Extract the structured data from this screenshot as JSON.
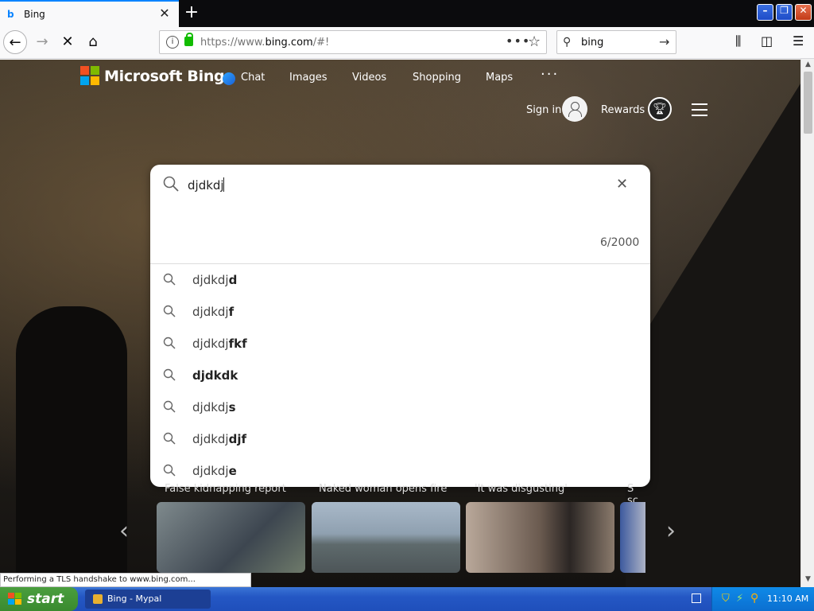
{
  "browser": {
    "tab_title": "Bing",
    "tab_favicon": "b",
    "url_host": "https://www.",
    "url_domain": "bing.com",
    "url_path": "/#!",
    "search_value": "bing",
    "status_text": "Performing a TLS handshake to www.bing.com..."
  },
  "bing": {
    "brand": "Microsoft Bing",
    "nav": [
      "Chat",
      "Images",
      "Videos",
      "Shopping",
      "Maps"
    ],
    "more": "···",
    "sign_in": "Sign in",
    "rewards": "Rewards",
    "query": "djdkdj",
    "char_count": "6/2000",
    "suggestions": [
      {
        "prefix": "djdkdj",
        "bold": "d"
      },
      {
        "prefix": "djdkdj",
        "bold": "f"
      },
      {
        "prefix": "djdkdj",
        "bold": "fkf"
      },
      {
        "prefix": "",
        "bold": "djdkdk"
      },
      {
        "prefix": "djdkdj",
        "bold": "s"
      },
      {
        "prefix": "djdkdj",
        "bold": "djf"
      },
      {
        "prefix": "djdkdj",
        "bold": "e"
      }
    ],
    "news": [
      {
        "caption": "False kidnapping report"
      },
      {
        "caption": "Naked woman opens fire"
      },
      {
        "caption": "'It was disgusting'"
      },
      {
        "caption": "S sc"
      }
    ]
  },
  "taskbar": {
    "start": "start",
    "task": "Bing - Mypal",
    "clock": "11:10 AM"
  },
  "colors": {
    "accent": "#0a84ff",
    "ms_red": "#f25022",
    "ms_green": "#7fba00",
    "ms_blue": "#00a4ef",
    "ms_yellow": "#ffb900"
  }
}
